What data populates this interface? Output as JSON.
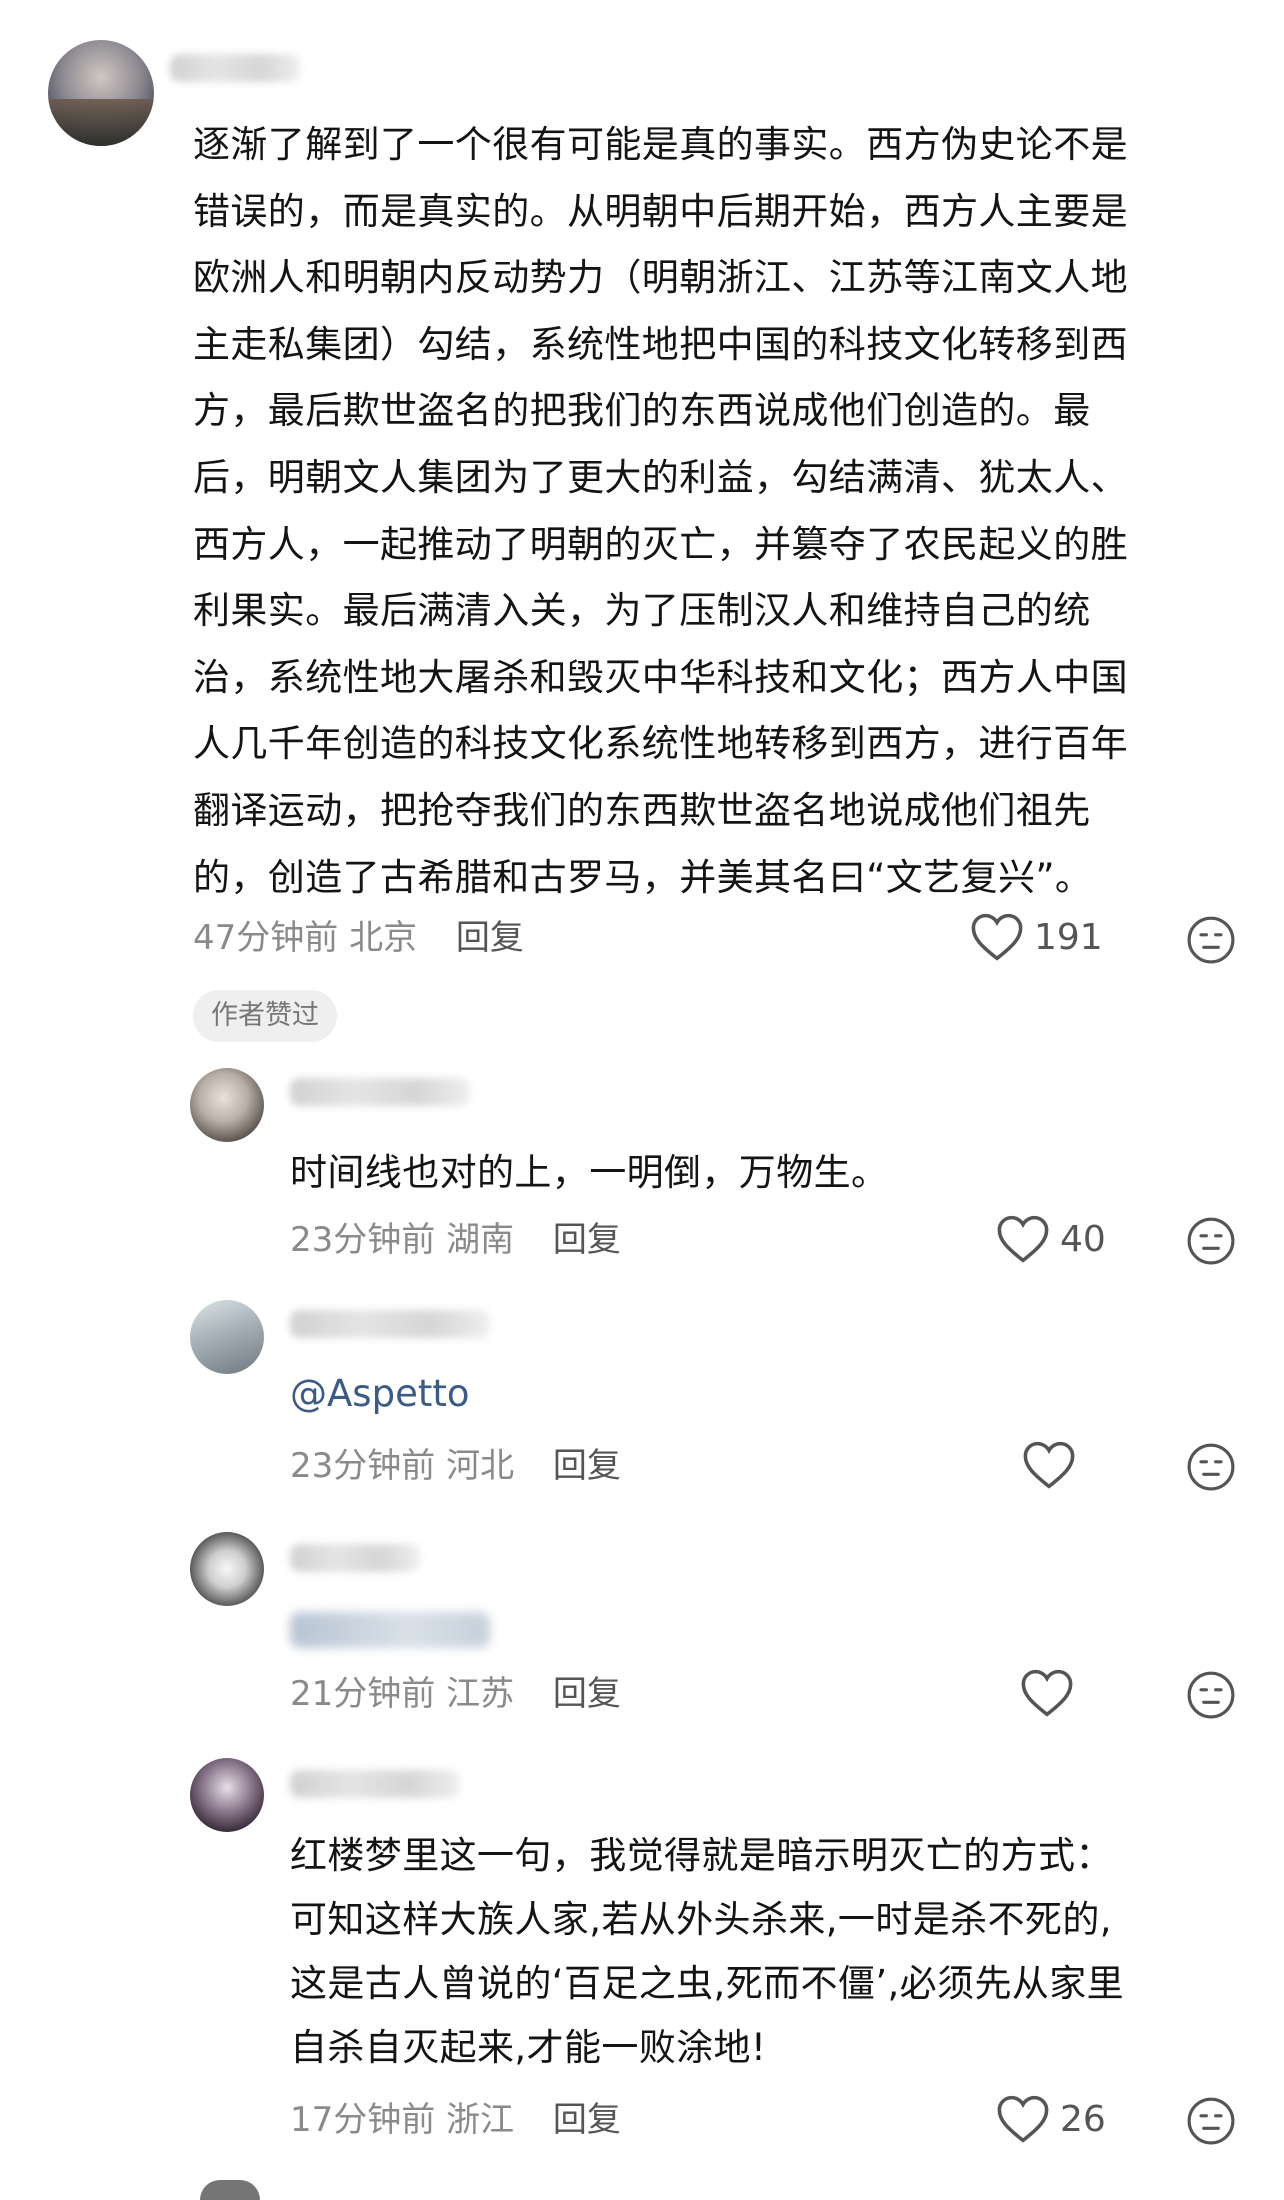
{
  "comments": [
    {
      "lines": [
        "逐渐了解到了一个很有可能是真的事实。西方伪史论不是",
        "错误的，而是真实的。从明朝中后期开始，西方人主要是",
        "欧洲人和明朝内反动势力（明朝浙江、江苏等江南文人地",
        "主走私集团）勾结，系统性地把中国的科技文化转移到西",
        "方，最后欺世盗名的把我们的东西说成他们创造的。最",
        "后，明朝文人集团为了更大的利益，勾结满清、犹太人、",
        "西方人，一起推动了明朝的灭亡，并篡夺了农民起义的胜",
        "利果实。最后满清入关，为了压制汉人和维持自己的统",
        "治，系统性地大屠杀和毁灭中华科技和文化；西方人中国",
        "人几千年创造的科技文化系统性地转移到西方，进行百年",
        "翻译运动，把抢夺我们的东西欺世盗名地说成他们祖先",
        "的，创造了古希腊和古罗马，并美其名曰“文艺复兴”。"
      ],
      "time": "47分钟前",
      "location": "北京",
      "reply": "回复",
      "likes": "191",
      "badge": "作者赞过"
    },
    {
      "lines": [
        "时间线也对的上，一明倒，万物生。"
      ],
      "time": "23分钟前",
      "location": "湖南",
      "reply": "回复",
      "likes": "40"
    },
    {
      "mention": "@Aspetto",
      "time": "23分钟前",
      "location": "河北",
      "reply": "回复",
      "likes": ""
    },
    {
      "time": "21分钟前",
      "location": "江苏",
      "reply": "回复",
      "likes": ""
    },
    {
      "lines": [
        "红楼梦里这一句，我觉得就是暗示明灭亡的方式：",
        "可知这样大族人家,若从外头杀来,一时是杀不死的,",
        "这是古人曾说的‘百足之虫,死而不僵’,必须先从家里",
        "自杀自灭起来,才能一败涂地!"
      ],
      "time": "17分钟前",
      "location": "浙江",
      "reply": "回复",
      "likes": "26"
    }
  ],
  "icons": {
    "like": "heart-outline-icon",
    "dislike": "neutral-face-icon"
  },
  "colors": {
    "text": "#141414",
    "meta": "#8a8a8a",
    "mention": "#3b5b86",
    "badge_bg": "#efefef"
  }
}
